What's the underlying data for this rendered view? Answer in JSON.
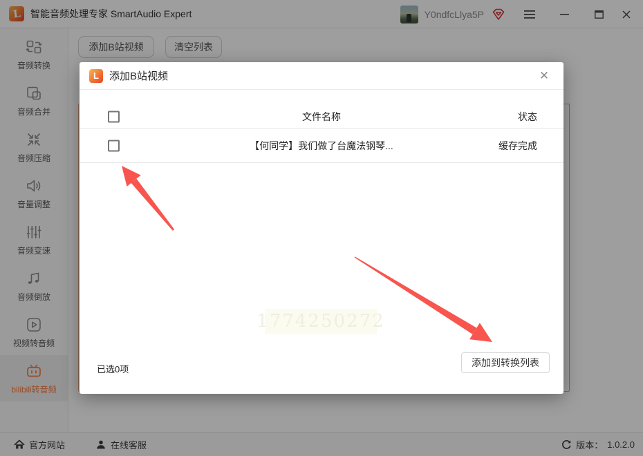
{
  "window": {
    "title": "智能音频处理专家 SmartAudio Expert",
    "username": "Y0ndfcLlya5P"
  },
  "sidebar": {
    "items": [
      {
        "label": "音频转换",
        "icon": "convert-icon",
        "active": false
      },
      {
        "label": "音频合并",
        "icon": "merge-icon",
        "active": false
      },
      {
        "label": "音频压缩",
        "icon": "compress-icon",
        "active": false
      },
      {
        "label": "音量调整",
        "icon": "volume-icon",
        "active": false
      },
      {
        "label": "音频变速",
        "icon": "speed-icon",
        "active": false
      },
      {
        "label": "音频倒放",
        "icon": "reverse-icon",
        "active": false
      },
      {
        "label": "视频转音频",
        "icon": "video-to-audio-icon",
        "active": false
      },
      {
        "label": "bilibili转音频",
        "icon": "bilibili-icon",
        "active": true
      }
    ]
  },
  "toolbar": {
    "add_bilibili_label": "添加B站视频",
    "clear_list_label": "清空列表"
  },
  "modal": {
    "title": "添加B站视频",
    "columns": {
      "name": "文件名称",
      "status": "状态"
    },
    "rows": [
      {
        "name": "【何同学】我们做了台魔法钢琴...",
        "status": "缓存完成"
      }
    ],
    "selected_text": "已选0项",
    "confirm_label": "添加到转换列表",
    "watermark": "1774250272"
  },
  "statusbar": {
    "website_label": "官方网站",
    "support_label": "在线客服",
    "version_label": "版本：",
    "version_value": "1.0.2.0"
  },
  "colors": {
    "accent_orange": "#f57c42",
    "logo_gradient_top": "#f9b552",
    "logo_gradient_bottom": "#e8432c",
    "arrow_red": "#f8554e",
    "vip_red": "#d9363e"
  }
}
